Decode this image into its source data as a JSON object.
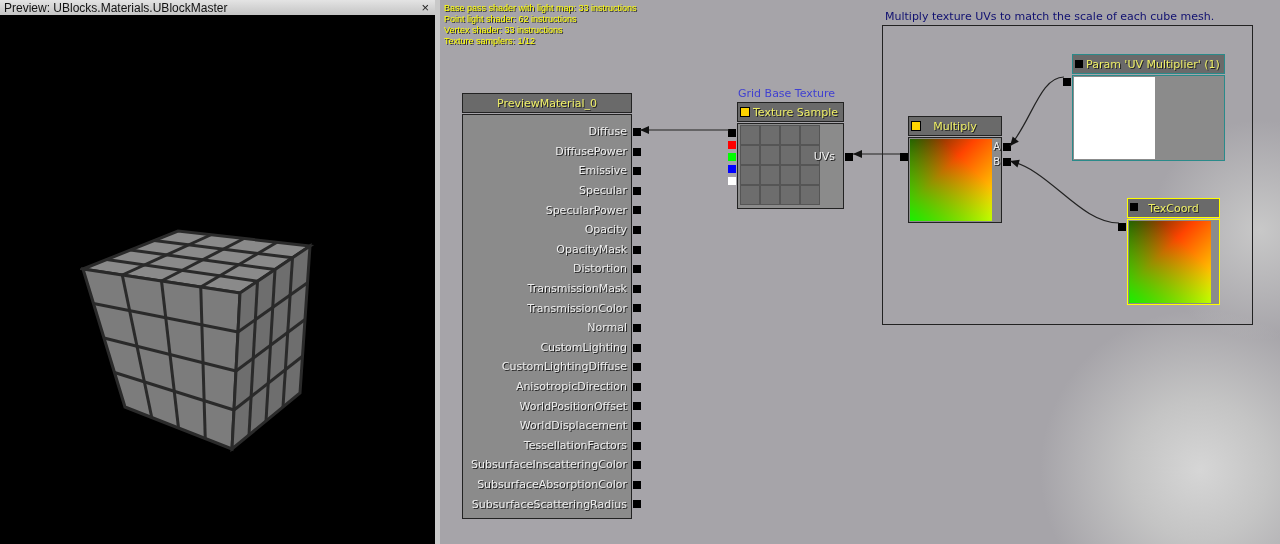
{
  "preview": {
    "title": "Preview: UBlocks.Materials.UBlockMaster",
    "close": "×"
  },
  "stats": [
    "Base pass shader with light map: 33 instructions",
    "Point light shader: 62 instructions",
    "Vertex shader: 33 instructions",
    "Texture samplers: 1/12"
  ],
  "comment": "Multiply texture UVs to match the scale of each cube mesh.",
  "nodes": [
    {
      "kind": "material",
      "title": "PreviewMaterial_0",
      "inputs": [
        "Diffuse",
        "DiffusePower",
        "Emissive",
        "Specular",
        "SpecularPower",
        "Opacity",
        "OpacityMask",
        "Distortion",
        "TransmissionMask",
        "TransmissionColor",
        "Normal",
        "CustomLighting",
        "CustomLightingDiffuse",
        "AnisotropicDirection",
        "WorldPositionOffset",
        "WorldDisplacement",
        "TessellationFactors",
        "SubsurfaceInscatteringColor",
        "SubsurfaceAbsorptionColor",
        "SubsurfaceScatteringRadius"
      ]
    },
    {
      "kind": "texture",
      "caption": "Grid Base Texture",
      "title": "Texture Sample",
      "inputs": [
        "UVs"
      ]
    },
    {
      "kind": "multiply",
      "title": "Multiply",
      "inputs": [
        "A",
        "B"
      ]
    },
    {
      "kind": "param",
      "title": "Param 'UV Multiplier' (1)"
    },
    {
      "kind": "texcoord",
      "title": "TexCoord"
    }
  ]
}
